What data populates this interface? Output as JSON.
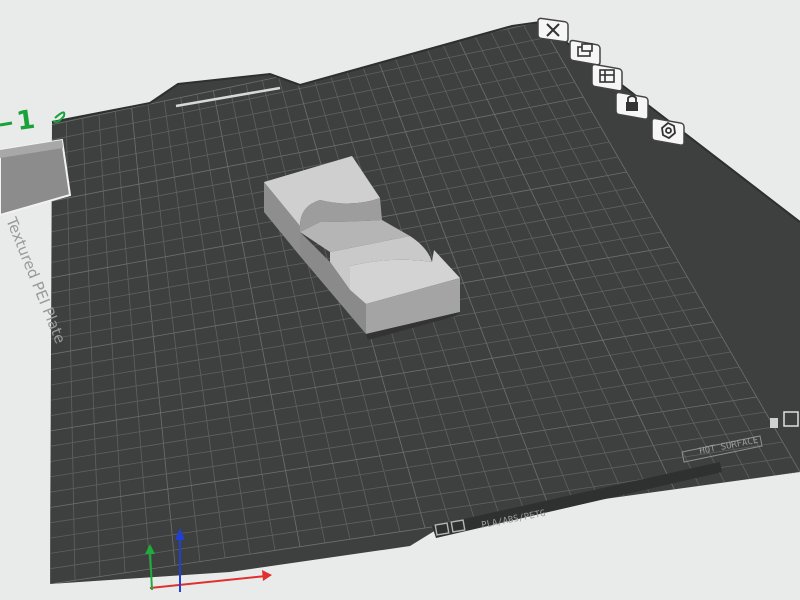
{
  "plate": {
    "name": "Textured PEI Plate",
    "filament_label": "PLA/ABS/PETG",
    "side_label": "HOT SURFACE"
  },
  "plate_index_label": "1",
  "toolbar": [
    {
      "name": "delete-plate-button",
      "icon": "close-icon"
    },
    {
      "name": "arrange-plate-button",
      "icon": "arrange-icon"
    },
    {
      "name": "orient-plate-button",
      "icon": "orient-icon"
    },
    {
      "name": "lock-plate-button",
      "icon": "lock-icon"
    },
    {
      "name": "plate-settings-button",
      "icon": "gear-icon"
    }
  ],
  "colors": {
    "background": "#e9eaea",
    "plate": "#3e3f3f",
    "grid": "#5f6060",
    "model": "#b8b8b8",
    "axis_x": "#e03030",
    "axis_y": "#1faa3a",
    "axis_z": "#2040d0",
    "accent": "#19a23a"
  }
}
